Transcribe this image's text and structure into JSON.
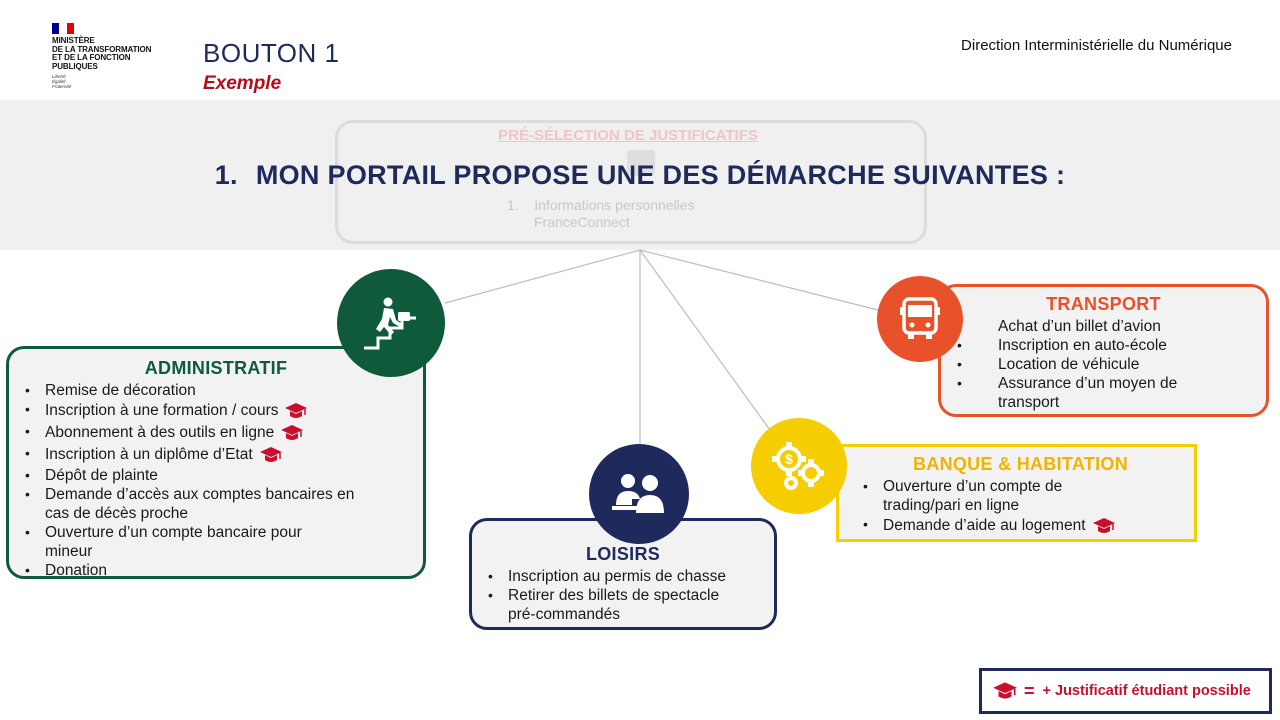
{
  "header": {
    "ministry_lines": [
      "MINISTÈRE",
      "DE LA TRANSFORMATION",
      "ET DE LA FONCTION",
      "PUBLIQUES"
    ],
    "motto_lines": [
      "Liberté",
      "Égalité",
      "Fraternité"
    ],
    "title": "BOUTON 1",
    "subtitle": "Exemple",
    "direction": "Direction Interministérielle du Numérique"
  },
  "background_card": {
    "title": "PRÉ-SÉLECTION DE JUSTIFICATIFS",
    "item_number": "1.",
    "item_lines": [
      "Informations personnelles",
      "FranceConnect"
    ]
  },
  "question": {
    "number": "1.",
    "text": "MON PORTAIL PROPOSE UNE DES DÉMARCHE SUIVANTES :"
  },
  "categories": {
    "administratif": {
      "title": "ADMINISTRATIF",
      "color": "#0e5a3a",
      "icon": "businessman-climbing-stairs-icon",
      "items": [
        {
          "text": "Remise de décoration",
          "student": false
        },
        {
          "text": "Inscription à une formation / cours",
          "student": true
        },
        {
          "text": "Abonnement à des outils en ligne",
          "student": true
        },
        {
          "text": "Inscription à un diplôme d’Etat",
          "student": true
        },
        {
          "text": "Dépôt de plainte",
          "student": false
        },
        {
          "text": "Demande d’accès aux comptes bancaires en cas de décès proche",
          "student": false
        },
        {
          "text": "Ouverture d’un compte bancaire pour mineur",
          "student": false
        },
        {
          "text": "Donation",
          "student": false
        }
      ]
    },
    "loisirs": {
      "title": "LOISIRS",
      "color": "#1f2a5c",
      "icon": "people-at-laptop-icon",
      "items": [
        {
          "text": "Inscription au permis de chasse",
          "student": false
        },
        {
          "text": "Retirer des billets de spectacle pré-commandés",
          "student": false
        }
      ]
    },
    "banque": {
      "title": "BANQUE & HABITATION",
      "color": "#f5cd00",
      "icon": "gears-dollar-icon",
      "items": [
        {
          "text": "Ouverture d’un compte de trading/pari en ligne",
          "student": false
        },
        {
          "text": "Demande d’aide au logement",
          "student": true
        }
      ]
    },
    "transport": {
      "title": "TRANSPORT",
      "color": "#e8512a",
      "icon": "bus-icon",
      "items": [
        {
          "text": "Achat d’un billet d’avion",
          "student": false
        },
        {
          "text": "Inscription en auto-école",
          "student": false
        },
        {
          "text": "Location de véhicule",
          "student": false
        },
        {
          "text": "Assurance d’un moyen de transport",
          "student": false
        }
      ]
    }
  },
  "legend": {
    "icon": "graduation-cap-icon",
    "equals": "=",
    "text": "+ Justificatif étudiant possible",
    "color": "#c8102e"
  }
}
